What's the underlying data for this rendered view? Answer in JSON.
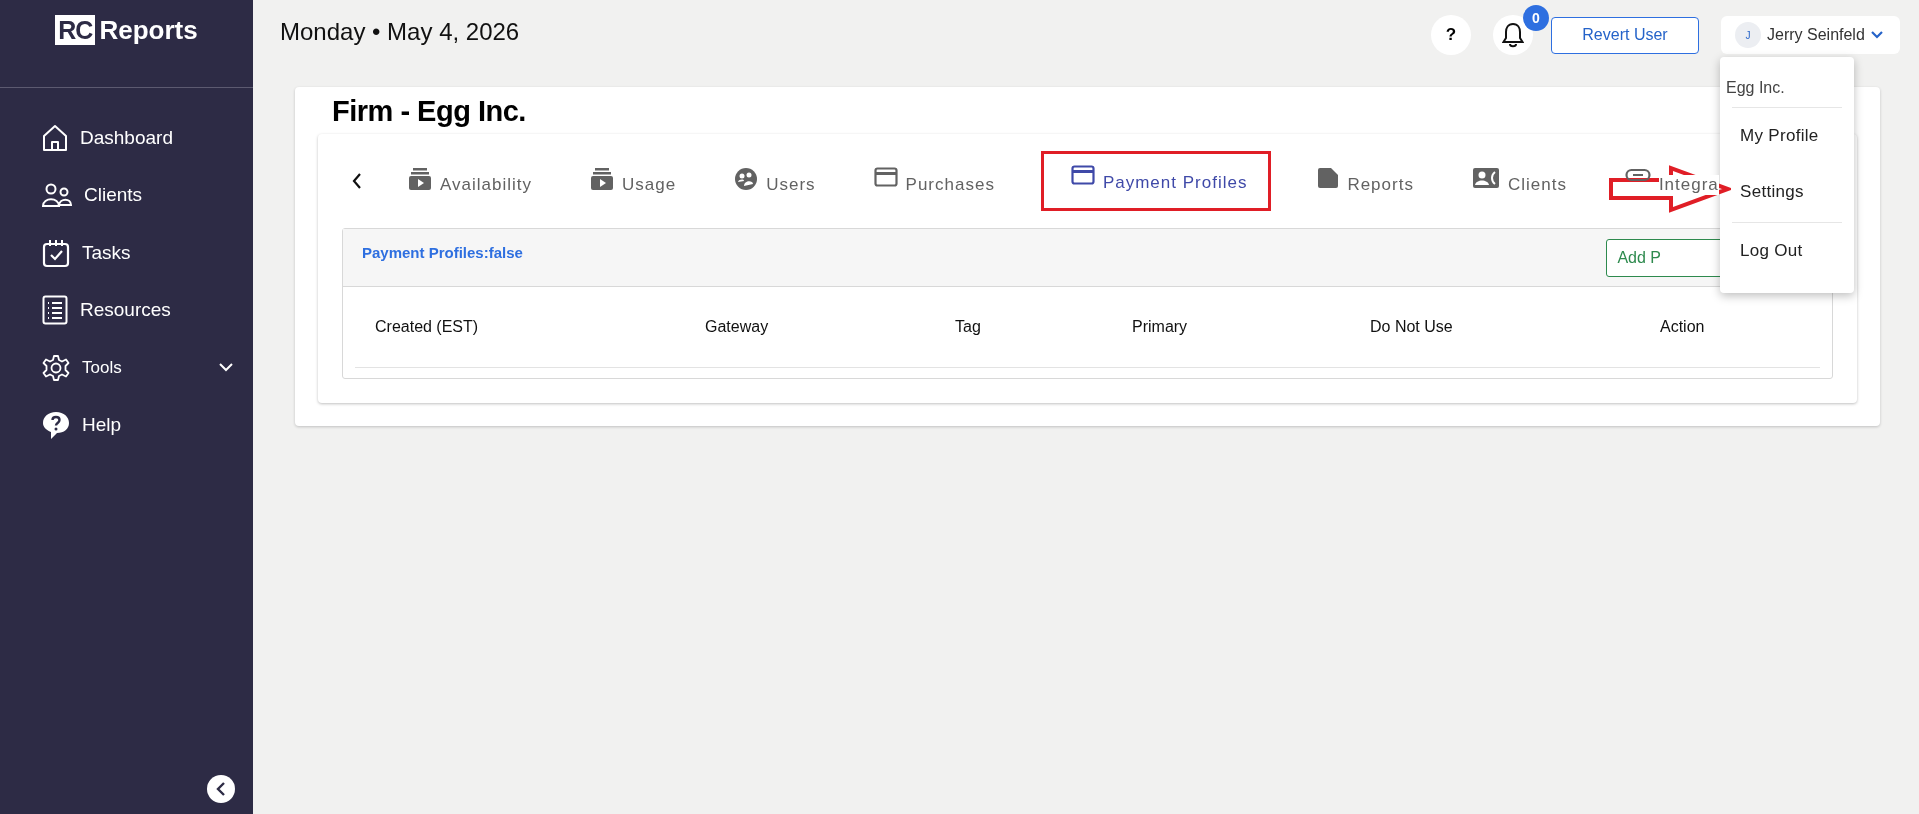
{
  "sidebar": {
    "logo_badge": "RC",
    "logo_text": "Reports",
    "items": [
      {
        "label": "Dashboard",
        "selected": false
      },
      {
        "label": "Clients",
        "selected": false
      },
      {
        "label": "Tasks",
        "selected": false
      },
      {
        "label": "Resources",
        "selected": false
      },
      {
        "label": "Tools",
        "selected": false,
        "expanded": false
      },
      {
        "label": "Help",
        "selected": false
      }
    ]
  },
  "header": {
    "date": "Monday • May 4, 2026",
    "help": "?",
    "notifications": "0",
    "revert_button": "Revert User",
    "user": {
      "initial": "J",
      "name": "Jerry Seinfeld"
    }
  },
  "user_menu": {
    "org": "Egg Inc.",
    "items": [
      {
        "label": "My Profile"
      },
      {
        "label": "Settings"
      },
      {
        "label": "Log Out"
      }
    ]
  },
  "page": {
    "title": "Firm - Egg Inc.",
    "tabs": [
      {
        "label": "Availability",
        "selected": false
      },
      {
        "label": "Usage",
        "selected": false
      },
      {
        "label": "Users",
        "selected": false
      },
      {
        "label": "Purchases",
        "selected": false
      },
      {
        "label": "Payment Profiles",
        "selected": true
      },
      {
        "label": "Reports",
        "selected": false
      },
      {
        "label": "Clients",
        "selected": false
      },
      {
        "label": "Integra",
        "selected": false
      }
    ],
    "panel": {
      "title": "Payment Profiles:false",
      "add_button": "Add P",
      "columns": [
        "Created (EST)",
        "Gateway",
        "Tag",
        "Primary",
        "Do Not Use",
        "Action"
      ]
    }
  }
}
